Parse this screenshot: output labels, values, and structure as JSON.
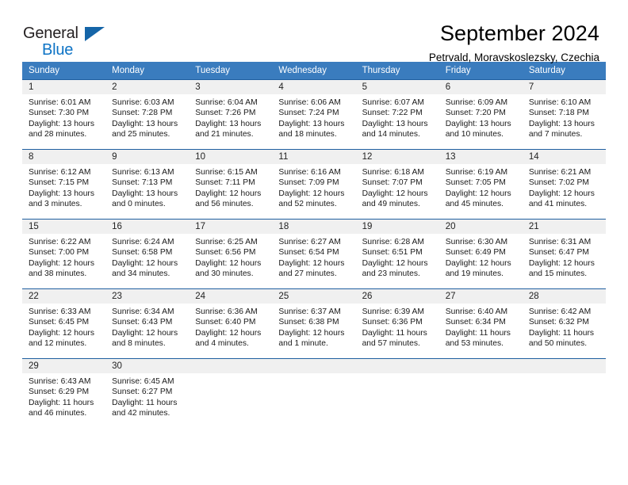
{
  "brand": {
    "line1": "General",
    "line2": "Blue",
    "triangle_color": "#1565a8"
  },
  "header": {
    "title": "September 2024",
    "subtitle": "Petrvald, Moravskoslezsky, Czechia"
  },
  "theme": {
    "header_bg": "#3a7cbe",
    "row_border": "#1f5fa0",
    "daynum_bg": "#f0f0f0",
    "brand_blue": "#0d73c5"
  },
  "weekday_headers": [
    "Sunday",
    "Monday",
    "Tuesday",
    "Wednesday",
    "Thursday",
    "Friday",
    "Saturday"
  ],
  "weeks": [
    [
      {
        "day": "1",
        "sunrise": "Sunrise: 6:01 AM",
        "sunset": "Sunset: 7:30 PM",
        "daylight1": "Daylight: 13 hours",
        "daylight2": "and 28 minutes."
      },
      {
        "day": "2",
        "sunrise": "Sunrise: 6:03 AM",
        "sunset": "Sunset: 7:28 PM",
        "daylight1": "Daylight: 13 hours",
        "daylight2": "and 25 minutes."
      },
      {
        "day": "3",
        "sunrise": "Sunrise: 6:04 AM",
        "sunset": "Sunset: 7:26 PM",
        "daylight1": "Daylight: 13 hours",
        "daylight2": "and 21 minutes."
      },
      {
        "day": "4",
        "sunrise": "Sunrise: 6:06 AM",
        "sunset": "Sunset: 7:24 PM",
        "daylight1": "Daylight: 13 hours",
        "daylight2": "and 18 minutes."
      },
      {
        "day": "5",
        "sunrise": "Sunrise: 6:07 AM",
        "sunset": "Sunset: 7:22 PM",
        "daylight1": "Daylight: 13 hours",
        "daylight2": "and 14 minutes."
      },
      {
        "day": "6",
        "sunrise": "Sunrise: 6:09 AM",
        "sunset": "Sunset: 7:20 PM",
        "daylight1": "Daylight: 13 hours",
        "daylight2": "and 10 minutes."
      },
      {
        "day": "7",
        "sunrise": "Sunrise: 6:10 AM",
        "sunset": "Sunset: 7:18 PM",
        "daylight1": "Daylight: 13 hours",
        "daylight2": "and 7 minutes."
      }
    ],
    [
      {
        "day": "8",
        "sunrise": "Sunrise: 6:12 AM",
        "sunset": "Sunset: 7:15 PM",
        "daylight1": "Daylight: 13 hours",
        "daylight2": "and 3 minutes."
      },
      {
        "day": "9",
        "sunrise": "Sunrise: 6:13 AM",
        "sunset": "Sunset: 7:13 PM",
        "daylight1": "Daylight: 13 hours",
        "daylight2": "and 0 minutes."
      },
      {
        "day": "10",
        "sunrise": "Sunrise: 6:15 AM",
        "sunset": "Sunset: 7:11 PM",
        "daylight1": "Daylight: 12 hours",
        "daylight2": "and 56 minutes."
      },
      {
        "day": "11",
        "sunrise": "Sunrise: 6:16 AM",
        "sunset": "Sunset: 7:09 PM",
        "daylight1": "Daylight: 12 hours",
        "daylight2": "and 52 minutes."
      },
      {
        "day": "12",
        "sunrise": "Sunrise: 6:18 AM",
        "sunset": "Sunset: 7:07 PM",
        "daylight1": "Daylight: 12 hours",
        "daylight2": "and 49 minutes."
      },
      {
        "day": "13",
        "sunrise": "Sunrise: 6:19 AM",
        "sunset": "Sunset: 7:05 PM",
        "daylight1": "Daylight: 12 hours",
        "daylight2": "and 45 minutes."
      },
      {
        "day": "14",
        "sunrise": "Sunrise: 6:21 AM",
        "sunset": "Sunset: 7:02 PM",
        "daylight1": "Daylight: 12 hours",
        "daylight2": "and 41 minutes."
      }
    ],
    [
      {
        "day": "15",
        "sunrise": "Sunrise: 6:22 AM",
        "sunset": "Sunset: 7:00 PM",
        "daylight1": "Daylight: 12 hours",
        "daylight2": "and 38 minutes."
      },
      {
        "day": "16",
        "sunrise": "Sunrise: 6:24 AM",
        "sunset": "Sunset: 6:58 PM",
        "daylight1": "Daylight: 12 hours",
        "daylight2": "and 34 minutes."
      },
      {
        "day": "17",
        "sunrise": "Sunrise: 6:25 AM",
        "sunset": "Sunset: 6:56 PM",
        "daylight1": "Daylight: 12 hours",
        "daylight2": "and 30 minutes."
      },
      {
        "day": "18",
        "sunrise": "Sunrise: 6:27 AM",
        "sunset": "Sunset: 6:54 PM",
        "daylight1": "Daylight: 12 hours",
        "daylight2": "and 27 minutes."
      },
      {
        "day": "19",
        "sunrise": "Sunrise: 6:28 AM",
        "sunset": "Sunset: 6:51 PM",
        "daylight1": "Daylight: 12 hours",
        "daylight2": "and 23 minutes."
      },
      {
        "day": "20",
        "sunrise": "Sunrise: 6:30 AM",
        "sunset": "Sunset: 6:49 PM",
        "daylight1": "Daylight: 12 hours",
        "daylight2": "and 19 minutes."
      },
      {
        "day": "21",
        "sunrise": "Sunrise: 6:31 AM",
        "sunset": "Sunset: 6:47 PM",
        "daylight1": "Daylight: 12 hours",
        "daylight2": "and 15 minutes."
      }
    ],
    [
      {
        "day": "22",
        "sunrise": "Sunrise: 6:33 AM",
        "sunset": "Sunset: 6:45 PM",
        "daylight1": "Daylight: 12 hours",
        "daylight2": "and 12 minutes."
      },
      {
        "day": "23",
        "sunrise": "Sunrise: 6:34 AM",
        "sunset": "Sunset: 6:43 PM",
        "daylight1": "Daylight: 12 hours",
        "daylight2": "and 8 minutes."
      },
      {
        "day": "24",
        "sunrise": "Sunrise: 6:36 AM",
        "sunset": "Sunset: 6:40 PM",
        "daylight1": "Daylight: 12 hours",
        "daylight2": "and 4 minutes."
      },
      {
        "day": "25",
        "sunrise": "Sunrise: 6:37 AM",
        "sunset": "Sunset: 6:38 PM",
        "daylight1": "Daylight: 12 hours",
        "daylight2": "and 1 minute."
      },
      {
        "day": "26",
        "sunrise": "Sunrise: 6:39 AM",
        "sunset": "Sunset: 6:36 PM",
        "daylight1": "Daylight: 11 hours",
        "daylight2": "and 57 minutes."
      },
      {
        "day": "27",
        "sunrise": "Sunrise: 6:40 AM",
        "sunset": "Sunset: 6:34 PM",
        "daylight1": "Daylight: 11 hours",
        "daylight2": "and 53 minutes."
      },
      {
        "day": "28",
        "sunrise": "Sunrise: 6:42 AM",
        "sunset": "Sunset: 6:32 PM",
        "daylight1": "Daylight: 11 hours",
        "daylight2": "and 50 minutes."
      }
    ],
    [
      {
        "day": "29",
        "sunrise": "Sunrise: 6:43 AM",
        "sunset": "Sunset: 6:29 PM",
        "daylight1": "Daylight: 11 hours",
        "daylight2": "and 46 minutes."
      },
      {
        "day": "30",
        "sunrise": "Sunrise: 6:45 AM",
        "sunset": "Sunset: 6:27 PM",
        "daylight1": "Daylight: 11 hours",
        "daylight2": "and 42 minutes."
      },
      {
        "day": "",
        "sunrise": "",
        "sunset": "",
        "daylight1": "",
        "daylight2": ""
      },
      {
        "day": "",
        "sunrise": "",
        "sunset": "",
        "daylight1": "",
        "daylight2": ""
      },
      {
        "day": "",
        "sunrise": "",
        "sunset": "",
        "daylight1": "",
        "daylight2": ""
      },
      {
        "day": "",
        "sunrise": "",
        "sunset": "",
        "daylight1": "",
        "daylight2": ""
      },
      {
        "day": "",
        "sunrise": "",
        "sunset": "",
        "daylight1": "",
        "daylight2": ""
      }
    ]
  ]
}
